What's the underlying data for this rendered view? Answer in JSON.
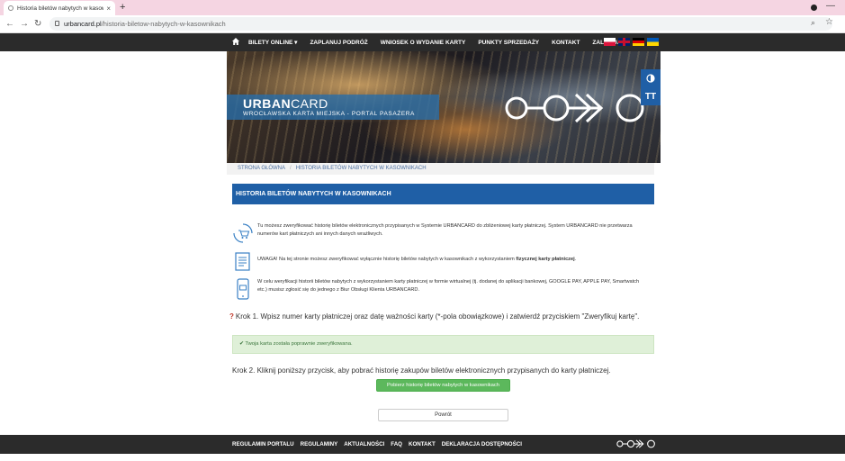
{
  "browser": {
    "tab_title": "Historia biletów nabytych w kasow",
    "tab_close": "×",
    "new_tab": "+",
    "minimize": "—",
    "url_host": "urbancard.pl",
    "url_path": "/historia-biletow-nabytych-w-kasownikach"
  },
  "topnav": {
    "items": [
      {
        "label": "BILETY ONLINE ▾"
      },
      {
        "label": "ZAPLANUJ PODRÓŻ"
      },
      {
        "label": "WNIOSEK O WYDANIE KARTY"
      },
      {
        "label": "PUNKTY SPRZEDAŻY"
      },
      {
        "label": "KONTAKT"
      },
      {
        "label": "ZALOGUJ"
      }
    ],
    "languages": [
      "pl",
      "en",
      "de",
      "ua"
    ]
  },
  "banner": {
    "brand_bold": "URBAN",
    "brand_light": "CARD",
    "subtitle": "WROCŁAWSKA KARTA MIEJSKA - PORTAL PASAŻERA",
    "font_tool_label": "TT"
  },
  "breadcrumb": {
    "home": "STRONA GŁÓWNA",
    "separator": "/",
    "current": "HISTORIA BILETÓW NABYTYCH W KASOWNIKACH"
  },
  "heading": "HISTORIA BILETÓW NABYTYCH W KASOWNIKACH",
  "info": {
    "row1": "Tu możesz zweryfikować historię biletów elektronicznych przypisanych w Systemie URBANCARD do zbliżeniowej karty płatniczej. System URBANCARD nie przetwarza numerów kart płatniczych ani innych danych wrażliwych.",
    "row2_prefix": "UWAGA! Na tej stronie możesz zweryfikować wyłącznie historię biletów nabytych w kasownikach z wykorzystaniem ",
    "row2_bold": "fizycznej karty płatniczej",
    "row2_suffix": ".",
    "row3": "W celu weryfikacji historii biletów nabytych z wykorzystaniem karty płatniczej w formie wirtualnej (tj. dodanej do aplikacji bankowej, GOOGLE PAY, APPLE PAY, Smartwatch etc.) musisz zgłosić się do jednego z Biur Obsługi Klienta URBANCARD."
  },
  "step1": {
    "marker": "?",
    "text": "Krok 1. Wpisz numer karty płatniczej oraz datę ważności karty (*-pola obowiązkowe) i zatwierdź przyciskiem \"Zweryfikuj kartę\"."
  },
  "success": {
    "check": "✔",
    "text": "Twoja karta została poprawnie zweryfikowana."
  },
  "step2": {
    "text": "Krok 2. Kliknij poniższy przycisk, aby pobrać historię zakupów biletów elektronicznych przypisanych do karty płatniczej."
  },
  "buttons": {
    "download": "Pobierz historię biletów nabytych w kasownikach",
    "back": "Powrót"
  },
  "footer": {
    "links": [
      {
        "label": "REGULAMIN PORTALU"
      },
      {
        "label": "REGULAMINY"
      },
      {
        "label": "AKTUALNOŚCI"
      },
      {
        "label": "FAQ"
      },
      {
        "label": "KONTAKT"
      },
      {
        "label": "DEKLARACJA DOSTĘPNOŚCI"
      }
    ]
  },
  "colors": {
    "accent_blue": "#1f5fa6",
    "dark_bar": "#2b2b2b",
    "success_bg": "#dff0d8",
    "success_text": "#3c763d",
    "button_green": "#5cb85c",
    "tab_bar": "#f5d5e2"
  }
}
